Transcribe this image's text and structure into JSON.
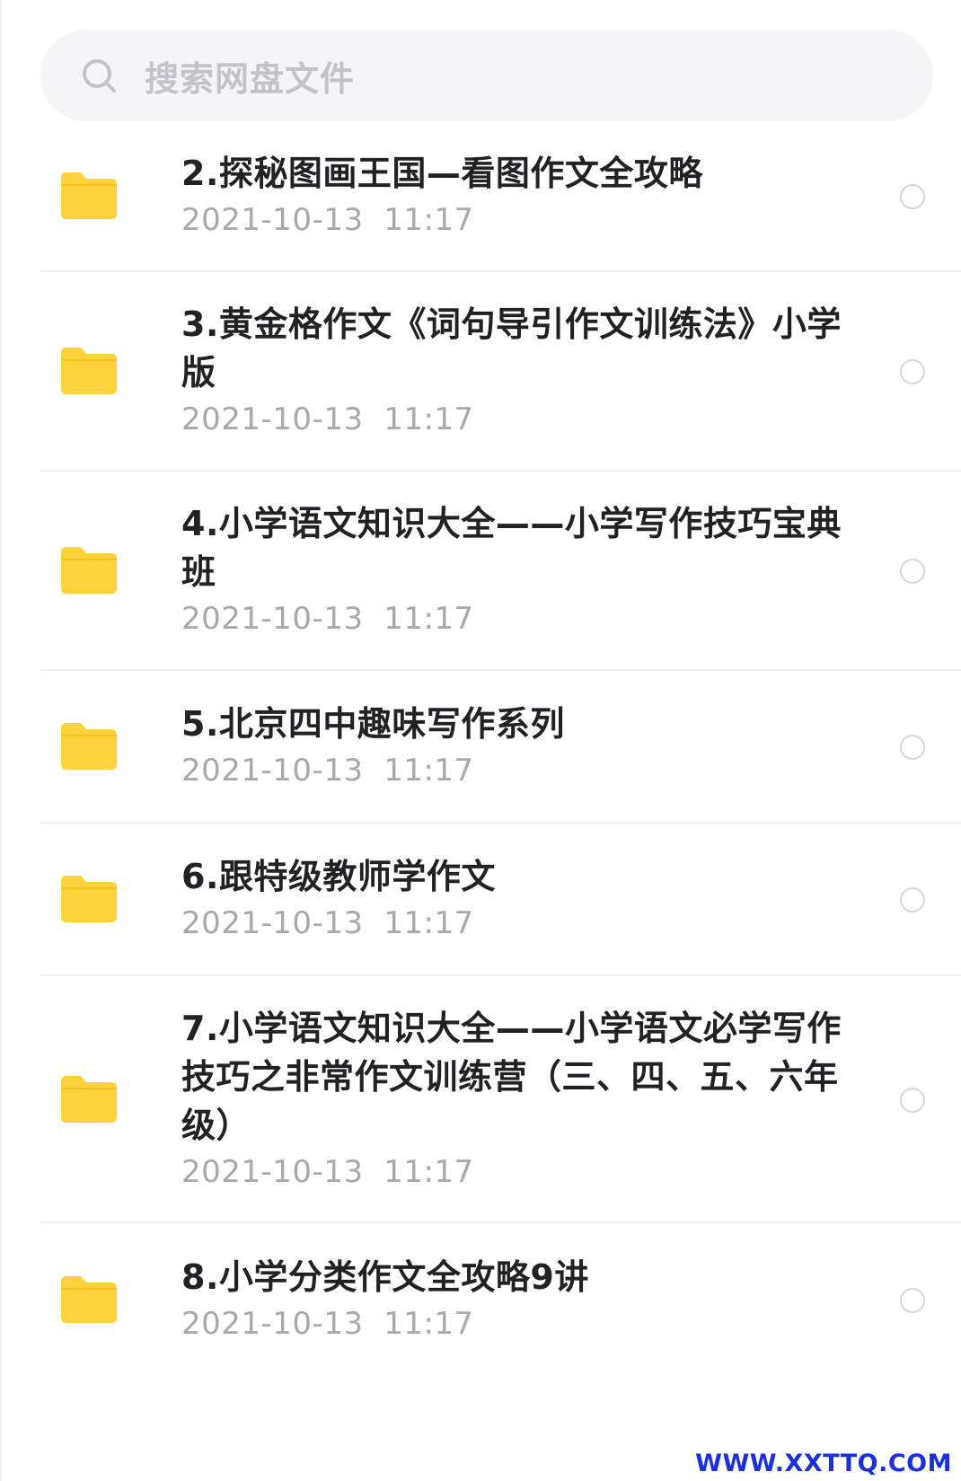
{
  "search": {
    "placeholder": "搜索网盘文件",
    "icon": "search-icon"
  },
  "files": [
    {
      "name": "2.探秘图画王国—看图作文全攻略",
      "time": "2021-10-13  11:17",
      "icon": "folder-icon"
    },
    {
      "name": "3.黄金格作文《词句导引作文训练法》小学版",
      "time": "2021-10-13  11:17",
      "icon": "folder-icon"
    },
    {
      "name": "4.小学语文知识大全——小学写作技巧宝典班",
      "time": "2021-10-13  11:17",
      "icon": "folder-icon"
    },
    {
      "name": "5.北京四中趣味写作系列",
      "time": "2021-10-13  11:17",
      "icon": "folder-icon"
    },
    {
      "name": "6.跟特级教师学作文",
      "time": "2021-10-13  11:17",
      "icon": "folder-icon"
    },
    {
      "name": "7.小学语文知识大全——小学语文必学写作技巧之非常作文训练营（三、四、五、六年级）",
      "time": "2021-10-13  11:17",
      "icon": "folder-icon"
    },
    {
      "name": "8.小学分类作文全攻略9讲",
      "time": "2021-10-13  11:17",
      "icon": "folder-icon"
    }
  ],
  "watermark": "WWW.XXTTQ.COM",
  "colors": {
    "folder": "#FFD23C",
    "watermark": "#1A2FE0"
  }
}
